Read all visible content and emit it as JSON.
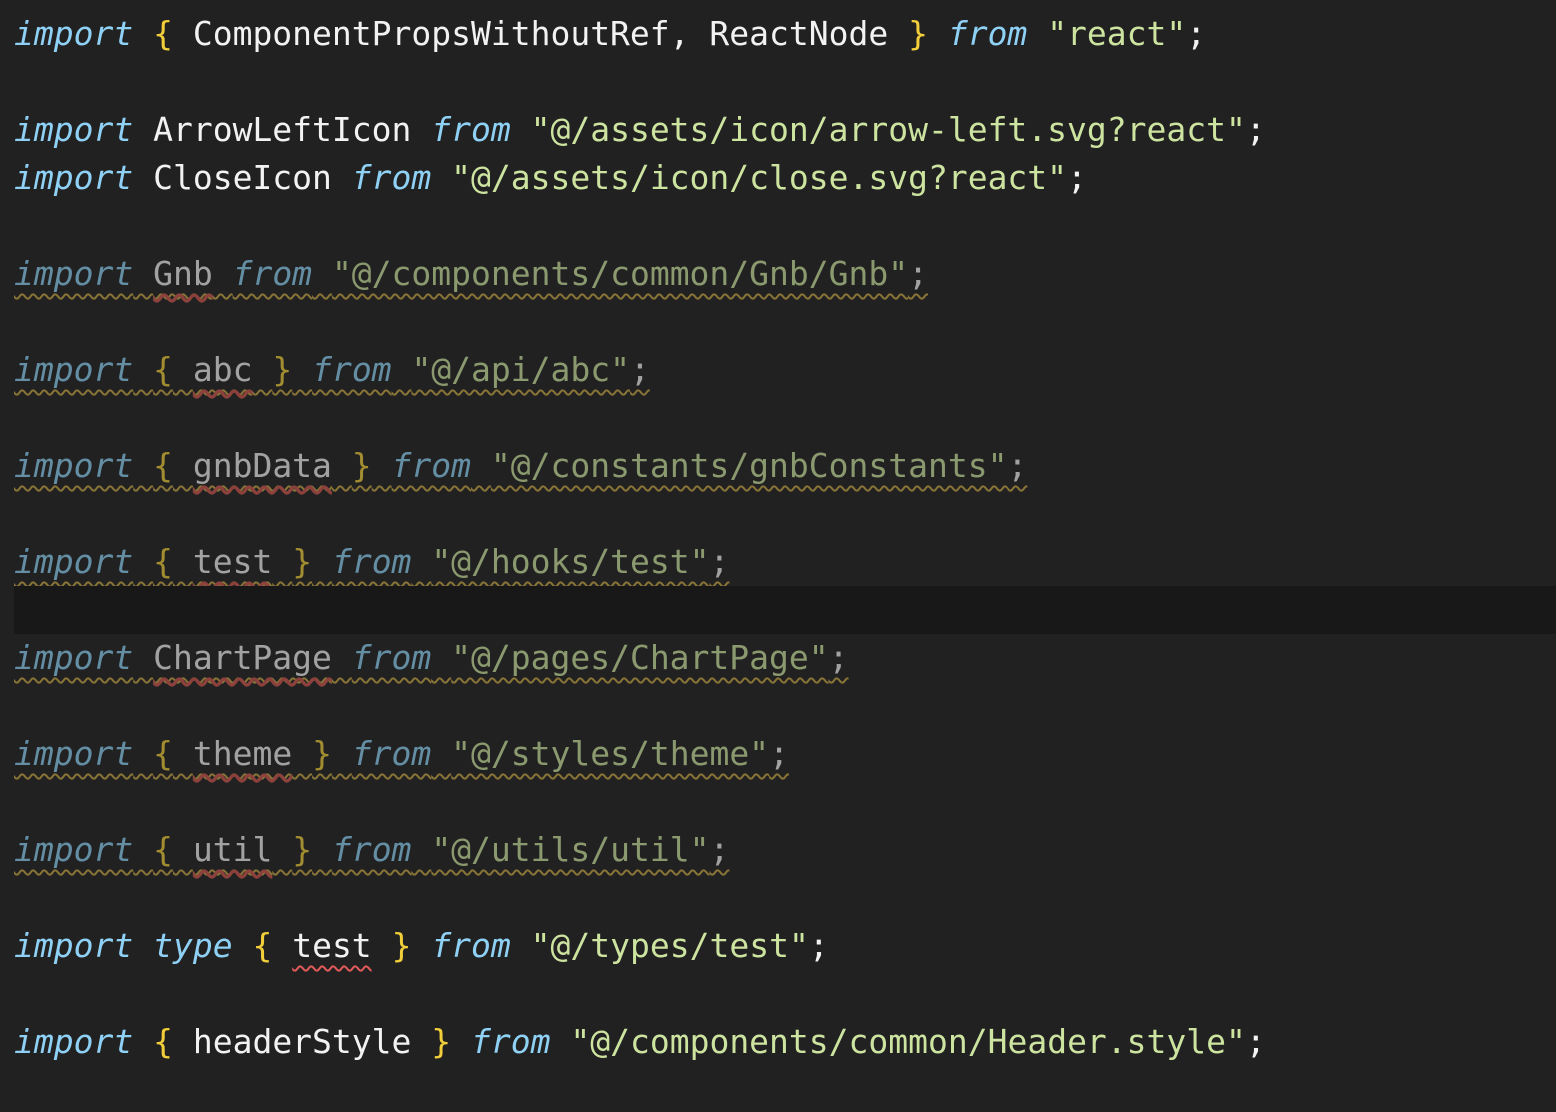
{
  "editor": {
    "language": "typescript",
    "lines": {
      "l1": {
        "kw1": "import",
        "b1": "{",
        "names": " ComponentPropsWithoutRef, ReactNode ",
        "b2": "}",
        "kw2": "from",
        "str": "\"react\"",
        "semi": ";"
      },
      "l3": {
        "kw1": "import",
        "name": "ArrowLeftIcon",
        "kw2": "from",
        "str": "\"@/assets/icon/arrow-left.svg?react\"",
        "semi": ";"
      },
      "l4": {
        "kw1": "import",
        "name": "CloseIcon",
        "kw2": "from",
        "str": "\"@/assets/icon/close.svg?react\"",
        "semi": ";"
      },
      "l6": {
        "kw1": "import",
        "name": "Gnb",
        "kw2": "from",
        "str": "\"@/components/common/Gnb/Gnb\"",
        "semi": ";"
      },
      "l8": {
        "kw1": "import",
        "b1": "{",
        "name": "abc",
        "b2": "}",
        "kw2": "from",
        "str": "\"@/api/abc\"",
        "semi": ";"
      },
      "l10": {
        "kw1": "import",
        "b1": "{",
        "name": "gnbData",
        "b2": "}",
        "kw2": "from",
        "str": "\"@/constants/gnbConstants\"",
        "semi": ";"
      },
      "l12": {
        "kw1": "import",
        "b1": "{",
        "name": "test",
        "b2": "}",
        "kw2": "from",
        "str": "\"@/hooks/test\"",
        "semi": ";"
      },
      "l14": {
        "kw1": "import",
        "name": "ChartPage",
        "kw2": "from",
        "str": "\"@/pages/ChartPage\"",
        "semi": ";"
      },
      "l16": {
        "kw1": "import",
        "b1": "{",
        "name": "theme",
        "b2": "}",
        "kw2": "from",
        "str": "\"@/styles/theme\"",
        "semi": ";"
      },
      "l18": {
        "kw1": "import",
        "b1": "{",
        "name": "util",
        "b2": "}",
        "kw2": "from",
        "str": "\"@/utils/util\"",
        "semi": ";"
      },
      "l20": {
        "kw1": "import",
        "kw_type": "type",
        "b1": "{",
        "name": "test",
        "b2": "}",
        "kw2": "from",
        "str": "\"@/types/test\"",
        "semi": ";"
      },
      "l22": {
        "kw1": "import",
        "b1": "{",
        "name": "headerStyle",
        "b2": "}",
        "kw2": "from",
        "str": "\"@/components/common/Header.style\"",
        "semi": ";"
      }
    }
  }
}
